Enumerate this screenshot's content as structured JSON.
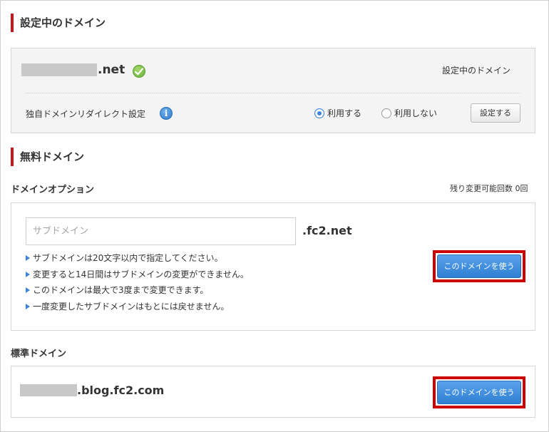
{
  "current_domain_section": {
    "title": "設定中のドメイン",
    "domain_suffix": ".net",
    "status_label": "設定中のドメイン",
    "redirect_label": "独自ドメインリダイレクト設定",
    "radio_use": "利用する",
    "radio_not_use": "利用しない",
    "selected_option": "利用する",
    "set_button": "設定する",
    "icons": [
      "check-icon",
      "info-icon"
    ]
  },
  "free_domain_section": {
    "title": "無料ドメイン",
    "option_heading": "ドメインオプション",
    "remaining_changes": "残り変更可能回数 0回",
    "subdomain_placeholder": "サブドメイン",
    "subdomain_value": "",
    "domain_suffix": ".fc2.net",
    "notes": [
      "サブドメインは20文字以内で指定してください。",
      "変更すると14日間はサブドメインの変更ができません。",
      "このドメインは最大で3度まで変更できます。",
      "一度変更したサブドメインはもとには戻せません。"
    ],
    "use_button": "このドメインを使う"
  },
  "standard_domain_section": {
    "heading": "標準ドメイン",
    "domain_suffix": ".blog.fc2.com",
    "use_button": "このドメインを使う"
  },
  "colors": {
    "accent_red": "#c8161d",
    "highlight_red": "#cc0000",
    "button_blue": "#3a85d8",
    "check_green": "#6ab13a"
  }
}
